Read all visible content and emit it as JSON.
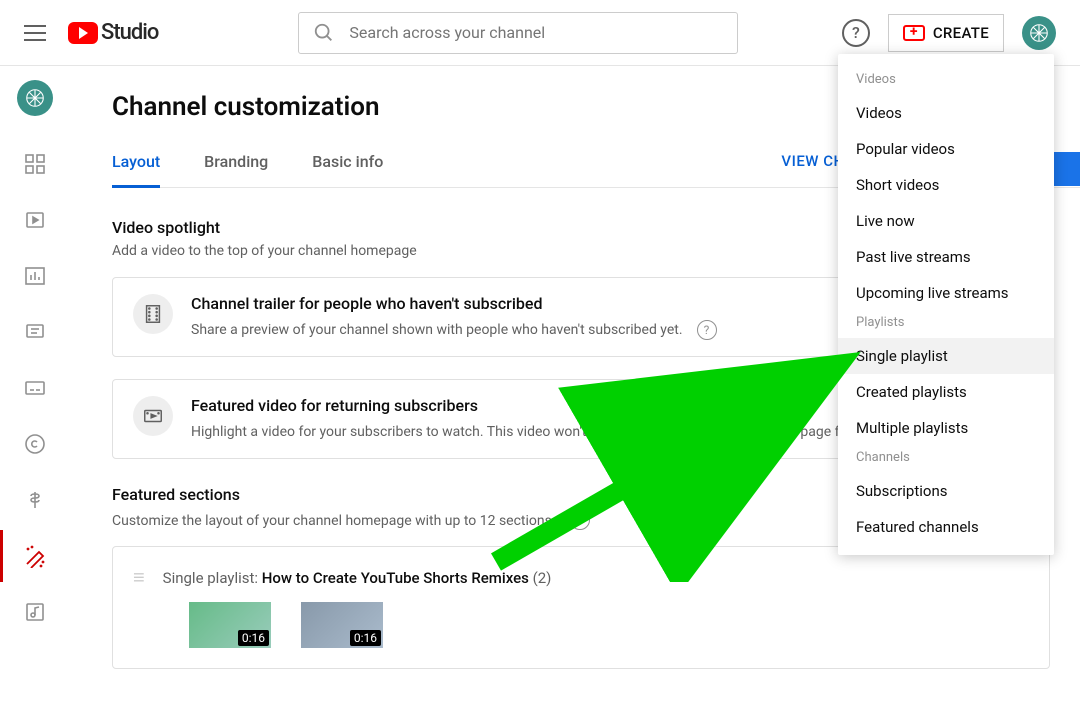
{
  "topbar": {
    "logo_text": "Studio",
    "search_placeholder": "Search across your channel",
    "create_label": "CREATE"
  },
  "page": {
    "title": "Channel customization",
    "tabs": [
      "Layout",
      "Branding",
      "Basic info"
    ],
    "view_channel": "VIEW CHAI"
  },
  "spotlight": {
    "heading": "Video spotlight",
    "sub": "Add a video to the top of your channel homepage",
    "card1_title": "Channel trailer for people who haven't subscribed",
    "card1_body": "Share a preview of your channel shown with people who haven't subscribed yet.",
    "card2_title": "Featured video for returning subscribers",
    "card2_body": "Highlight a video for your subscribers to watch. This video won't be shown again at the top of your page for s watched it."
  },
  "featured": {
    "heading": "Featured sections",
    "sub": "Customize the layout of your channel homepage with up to 12 sections.",
    "pl_prefix": "Single playlist: ",
    "pl_name": "How to Create YouTube Shorts Remixes",
    "pl_count": "(2)",
    "dur1": "0:16",
    "dur2": "0:16"
  },
  "dropdown": {
    "videos_head": "Videos",
    "videos": [
      "Videos",
      "Popular videos",
      "Short videos",
      "Live now",
      "Past live streams",
      "Upcoming live streams"
    ],
    "playlists_head": "Playlists",
    "playlists": [
      "Single playlist",
      "Created playlists",
      "Multiple playlists"
    ],
    "channels_head": "Channels",
    "channels": [
      "Subscriptions",
      "Featured channels"
    ]
  }
}
